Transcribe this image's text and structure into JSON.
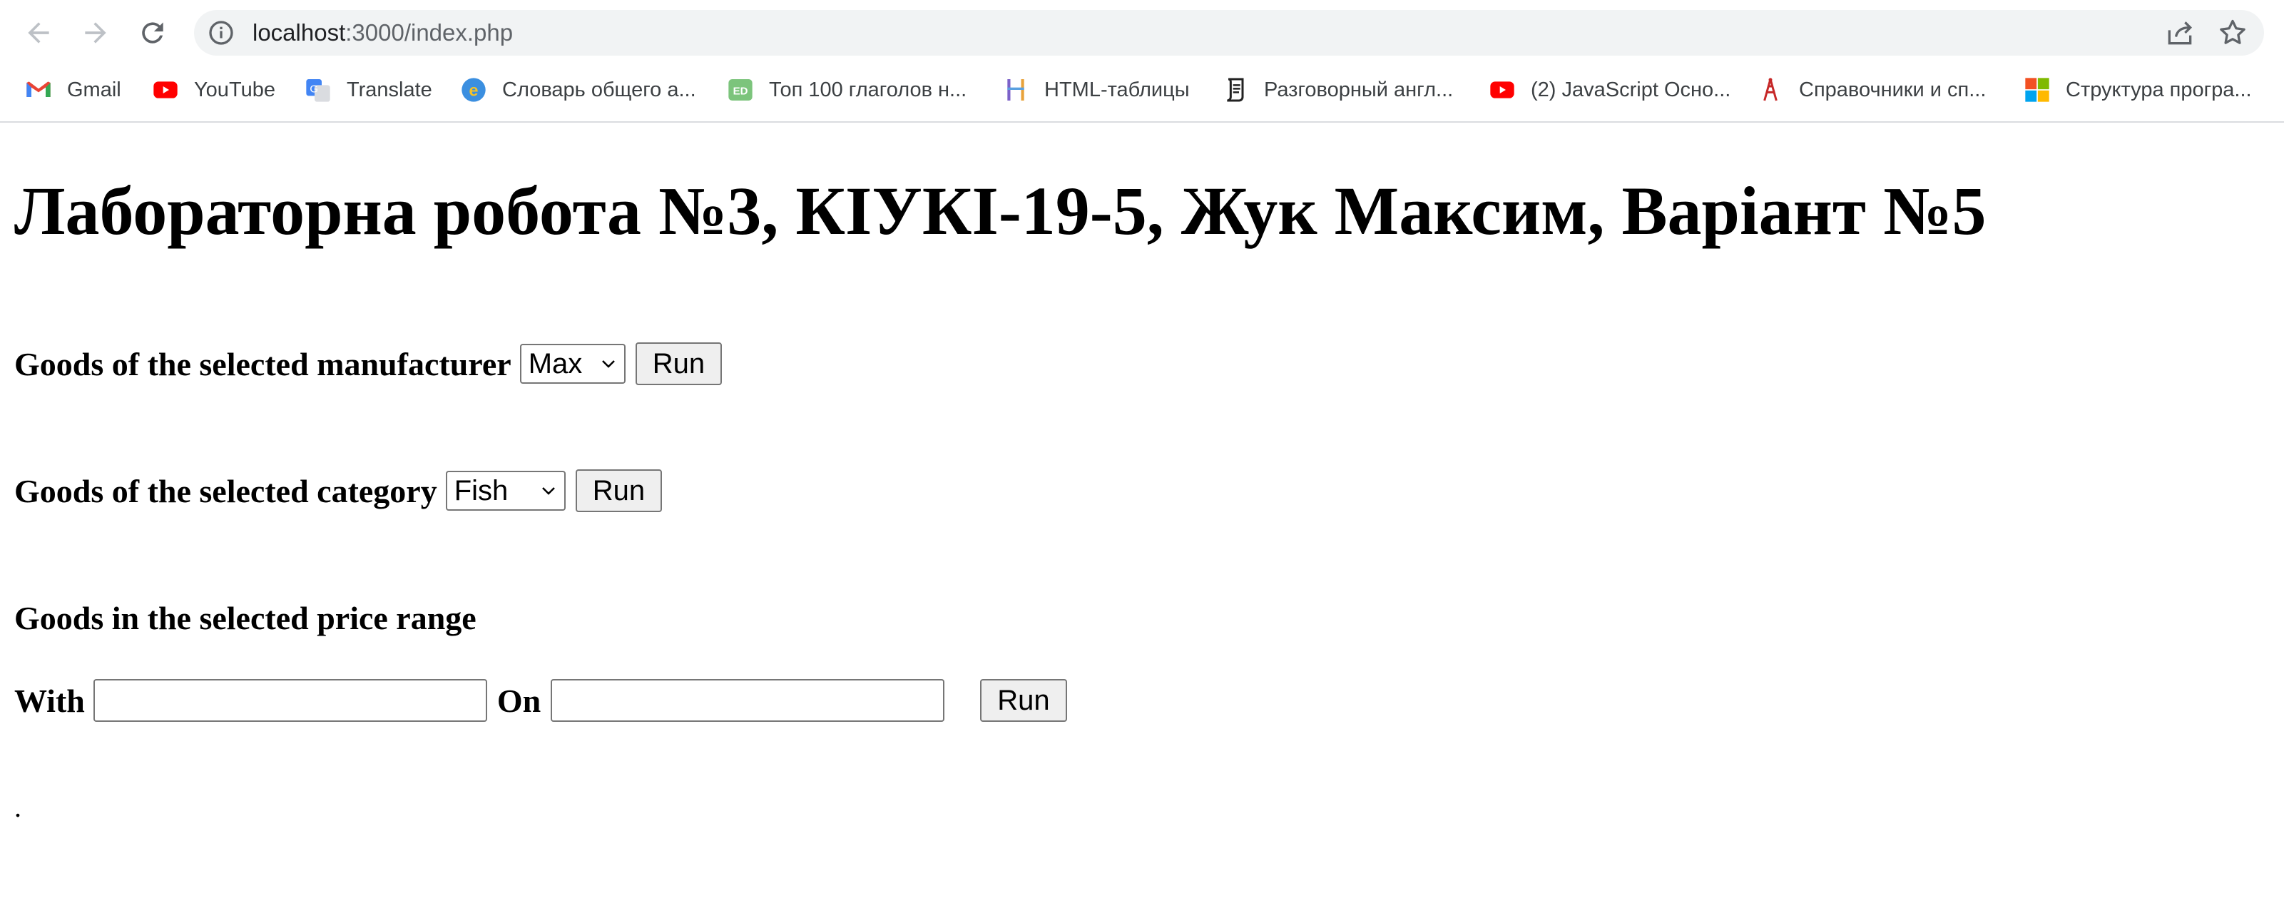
{
  "browser": {
    "url_host": "localhost",
    "url_rest": ":3000/index.php",
    "bookmarks": [
      {
        "label": "Gmail",
        "icon": "gmail-icon"
      },
      {
        "label": "YouTube",
        "icon": "youtube-icon"
      },
      {
        "label": "Translate",
        "icon": "translate-icon"
      },
      {
        "label": "Словарь общего а...",
        "icon": "dictionary-icon"
      },
      {
        "label": "Топ 100 глаголов н...",
        "icon": "ed-icon"
      },
      {
        "label": "HTML-таблицы",
        "icon": "html-table-icon"
      },
      {
        "label": "Разговорный англ...",
        "icon": "scroll-icon"
      },
      {
        "label": "(2) JavaScript Осно...",
        "icon": "youtube-icon"
      },
      {
        "label": "Справочники и сп...",
        "icon": "tower-icon"
      },
      {
        "label": "Структура програ...",
        "icon": "microsoft-icon"
      }
    ]
  },
  "page": {
    "title": "Лабораторна робота №3, КІУКІ-19-5, Жук Максим, Варіант №5",
    "manufacturer": {
      "label": "Goods of the selected manufacturer",
      "selected": "Max",
      "run_label": "Run"
    },
    "category": {
      "label": "Goods of the selected category",
      "selected": "Fish",
      "run_label": "Run"
    },
    "price": {
      "heading": "Goods in the selected price range",
      "with_label": "With",
      "with_value": "",
      "on_label": "On",
      "on_value": "",
      "run_label": "Run"
    },
    "footer_text": "."
  }
}
